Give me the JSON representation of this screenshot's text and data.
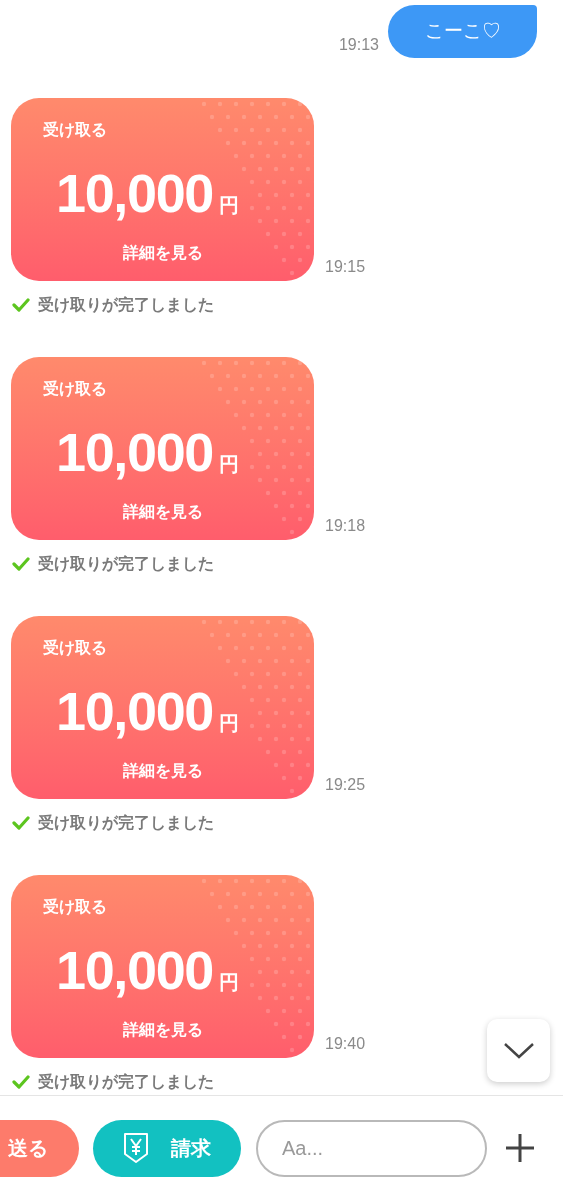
{
  "messages": [
    {
      "kind": "sent",
      "text": "こーこ♡",
      "time": "19:13"
    },
    {
      "kind": "payment",
      "label": "受け取る",
      "amount": "10,000",
      "currency": "円",
      "link": "詳細を見る",
      "time": "19:15",
      "status": "受け取りが完了しました"
    },
    {
      "kind": "payment",
      "label": "受け取る",
      "amount": "10,000",
      "currency": "円",
      "link": "詳細を見る",
      "time": "19:18",
      "status": "受け取りが完了しました"
    },
    {
      "kind": "payment",
      "label": "受け取る",
      "amount": "10,000",
      "currency": "円",
      "link": "詳細を見る",
      "time": "19:25",
      "status": "受け取りが完了しました"
    },
    {
      "kind": "payment",
      "label": "受け取る",
      "amount": "10,000",
      "currency": "円",
      "link": "詳細を見る",
      "time": "19:40",
      "status": "受け取りが完了しました"
    }
  ],
  "bottom_bar": {
    "send_button": "送る",
    "request_button": "請求",
    "input": {
      "placeholder": "Aa..."
    }
  }
}
